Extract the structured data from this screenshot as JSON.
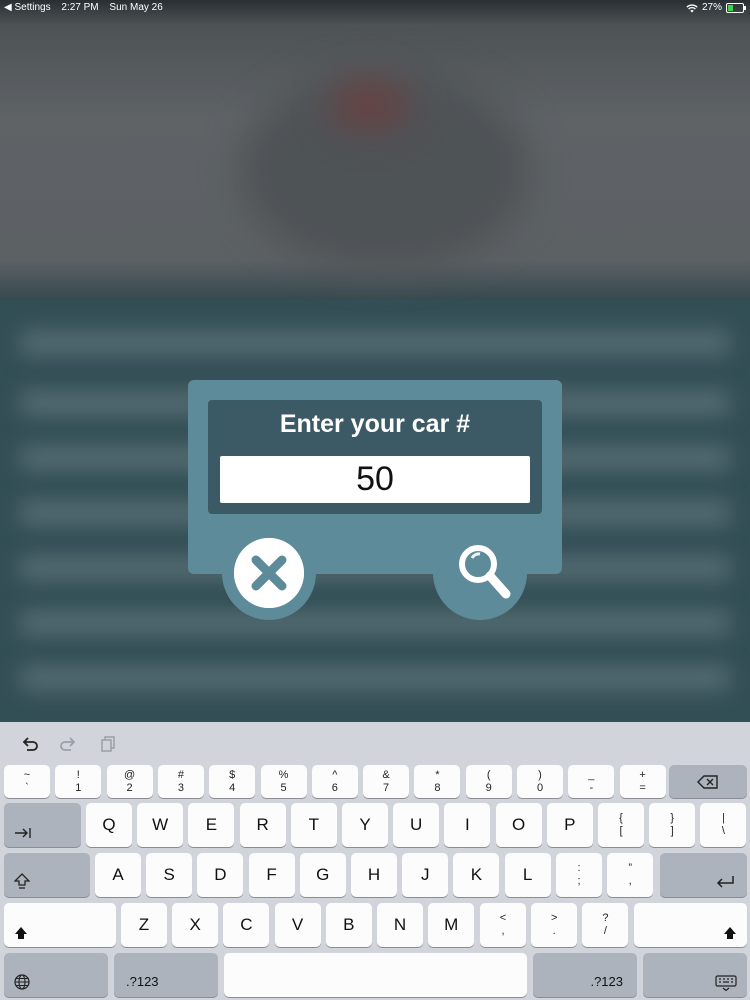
{
  "status_bar": {
    "back_label": "◀ Settings",
    "time": "2:27 PM",
    "date": "Sun May 26",
    "battery": "27%"
  },
  "dialog": {
    "title": "Enter your car #",
    "input_value": "50",
    "cancel_icon": "close-icon",
    "search_icon": "search-icon"
  },
  "keyboard": {
    "toolbar": {
      "undo_icon": "undo-icon",
      "redo_icon": "redo-icon",
      "paste_icon": "paste-icon"
    },
    "row_numbers": [
      {
        "top": "~",
        "bottom": "`"
      },
      {
        "top": "!",
        "bottom": "1"
      },
      {
        "top": "@",
        "bottom": "2"
      },
      {
        "top": "#",
        "bottom": "3"
      },
      {
        "top": "$",
        "bottom": "4"
      },
      {
        "top": "%",
        "bottom": "5"
      },
      {
        "top": "^",
        "bottom": "6"
      },
      {
        "top": "&",
        "bottom": "7"
      },
      {
        "top": "*",
        "bottom": "8"
      },
      {
        "top": "(",
        "bottom": "9"
      },
      {
        "top": ")",
        "bottom": "0"
      },
      {
        "top": "_",
        "bottom": "-"
      },
      {
        "top": "+",
        "bottom": "="
      }
    ],
    "row_qwerty": [
      "Q",
      "W",
      "E",
      "R",
      "T",
      "Y",
      "U",
      "I",
      "O",
      "P"
    ],
    "row_qwerty_extra": [
      {
        "top": "{",
        "bottom": "["
      },
      {
        "top": "}",
        "bottom": "]"
      },
      {
        "top": "|",
        "bottom": "\\"
      }
    ],
    "row_asdf": [
      "A",
      "S",
      "D",
      "F",
      "G",
      "H",
      "J",
      "K",
      "L"
    ],
    "row_asdf_extra": [
      {
        "top": ":",
        "bottom": ";"
      },
      {
        "top": "”",
        "bottom": ","
      }
    ],
    "row_zxcv": [
      "Z",
      "X",
      "C",
      "V",
      "B",
      "N",
      "M"
    ],
    "row_zxcv_extra": [
      {
        "top": "<",
        "bottom": ","
      },
      {
        "top": ">",
        "bottom": "."
      },
      {
        "top": "?",
        "bottom": "/"
      }
    ],
    "numbers_label_left": ".?123",
    "numbers_label_right": ".?123"
  }
}
